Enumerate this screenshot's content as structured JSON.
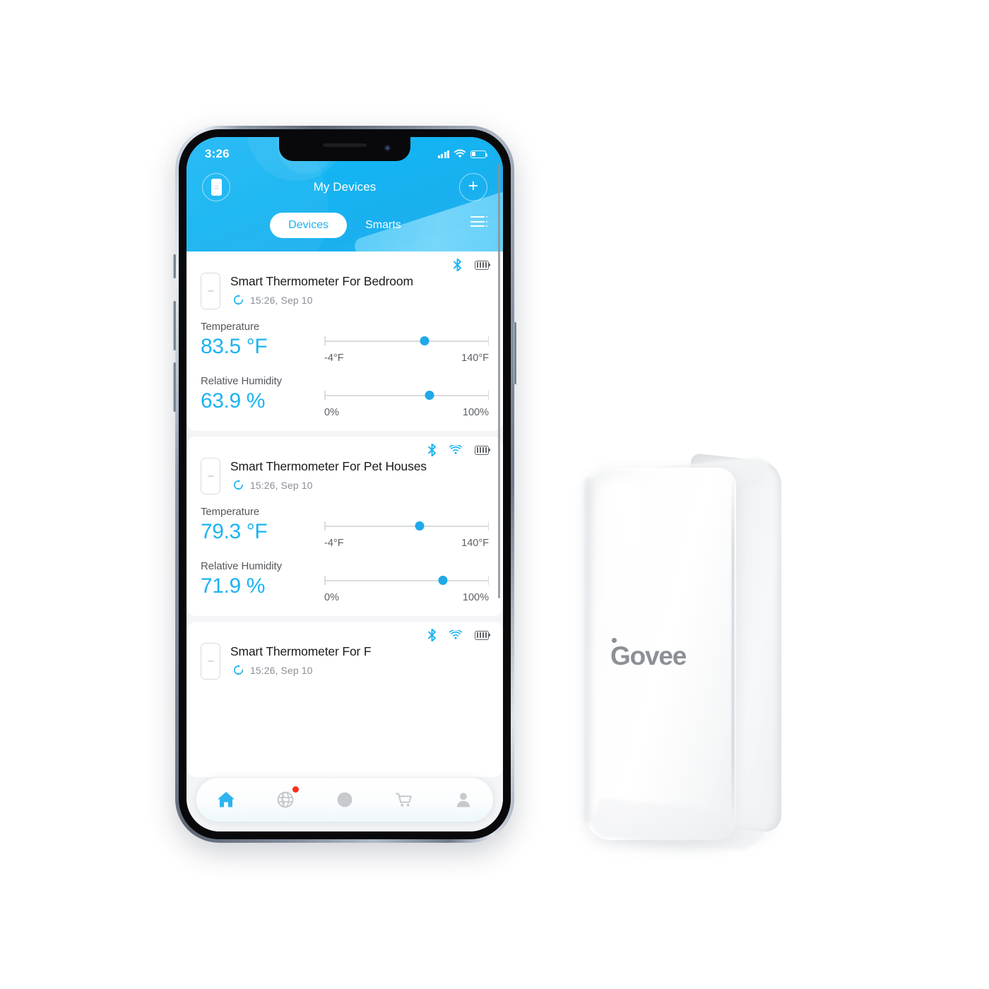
{
  "app": {
    "status_bar": {
      "clock": "3:26",
      "signal_icon": "signal-bars-icon",
      "wifi_icon": "wifi-icon",
      "battery_icon": "battery-icon",
      "battery_level": "28%"
    },
    "header": {
      "title": "My Devices",
      "left_button_icon": "device-thumbnail-icon",
      "add_button_label": "+",
      "menu_icon": "list-menu-icon",
      "tabs": [
        {
          "label": "Devices",
          "active": true
        },
        {
          "label": "Smarts",
          "active": false
        }
      ]
    },
    "devices": [
      {
        "name": "Smart Thermometer For Bedroom",
        "sync_time": "15:26,  Sep 10",
        "sync_icon": "refresh-sync-icon",
        "thumbnail_icon": "thermometer-device-icon",
        "status_icons": [
          "bluetooth-icon",
          "battery-icon"
        ],
        "metrics": [
          {
            "label": "Temperature",
            "value": "83.5 °F",
            "min_label": "-4°F",
            "max_label": "140°F",
            "min": -4,
            "max": 140,
            "current": 83.5
          },
          {
            "label": "Relative Humidity",
            "value": "63.9 %",
            "min_label": "0%",
            "max_label": "100%",
            "min": 0,
            "max": 100,
            "current": 63.9
          }
        ]
      },
      {
        "name": "Smart Thermometer For Pet Houses",
        "sync_time": "15:26,  Sep 10",
        "sync_icon": "refresh-sync-icon",
        "thumbnail_icon": "thermometer-device-icon",
        "status_icons": [
          "bluetooth-icon",
          "wifi-icon",
          "battery-icon"
        ],
        "metrics": [
          {
            "label": "Temperature",
            "value": "79.3 °F",
            "min_label": "-4°F",
            "max_label": "140°F",
            "min": -4,
            "max": 140,
            "current": 79.3
          },
          {
            "label": "Relative Humidity",
            "value": "71.9 %",
            "min_label": "0%",
            "max_label": "100%",
            "min": 0,
            "max": 100,
            "current": 71.9
          }
        ]
      },
      {
        "name": "Smart Thermometer For F",
        "sync_time": "15:26,  Sep 10",
        "sync_icon": "refresh-sync-icon",
        "thumbnail_icon": "thermometer-device-icon",
        "status_icons": [
          "bluetooth-icon",
          "wifi-icon",
          "battery-icon"
        ],
        "metrics": []
      }
    ],
    "tabbar": [
      {
        "name": "home",
        "icon": "home-icon",
        "active": true,
        "badge": false
      },
      {
        "name": "discover",
        "icon": "globe-icon",
        "active": false,
        "badge": true
      },
      {
        "name": "explore",
        "icon": "compass-icon",
        "active": false,
        "badge": false
      },
      {
        "name": "store",
        "icon": "shopping-cart-icon",
        "active": false,
        "badge": false
      },
      {
        "name": "profile",
        "icon": "person-icon",
        "active": false,
        "badge": false
      }
    ]
  },
  "product": {
    "brand_logo_text": "ovee",
    "brand_name": "Govee"
  },
  "colors": {
    "accent_blue": "#1cb3f0",
    "header_blue": "#17b5f2",
    "value_blue": "#1fa9e8",
    "badge_red": "#fb2c21",
    "text_dark": "#1b1b1d",
    "text_muted": "#8a8f96",
    "logo_gray": "#8c9096"
  }
}
